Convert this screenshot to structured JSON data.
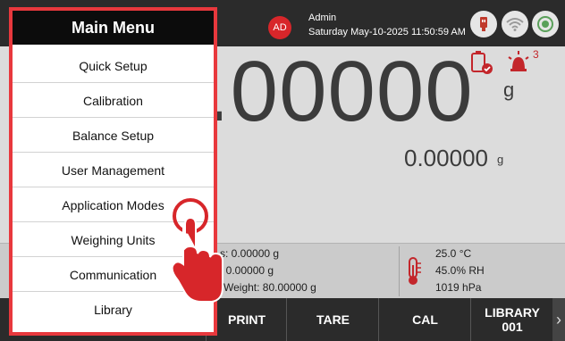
{
  "header": {
    "avatar_initials": "AD",
    "user_name": "Admin",
    "datetime": "Saturday May-10-2025 11:50:59 AM",
    "icons": [
      "usb-icon",
      "wifi-icon",
      "power-icon"
    ]
  },
  "main": {
    "weight_value": ".00000",
    "weight_unit": "g",
    "secondary_value": "0.00000",
    "secondary_unit": "g",
    "alarm_count": "3"
  },
  "info": {
    "stats": [
      "s: 0.00000 g",
      ": 0.00000 g",
      "-Weight: 80.00000 g"
    ],
    "environment": [
      "25.0 °C",
      "45.0% RH",
      "1019 hPa"
    ]
  },
  "buttons": {
    "print": "PRINT",
    "tare": "TARE",
    "cal": "CAL",
    "library_line1": "LIBRARY",
    "library_line2": "001"
  },
  "menu": {
    "title": "Main Menu",
    "items": [
      "Quick Setup",
      "Calibration",
      "Balance Setup",
      "User Management",
      "Application Modes",
      "Weighing Units",
      "Communication",
      "Library"
    ]
  },
  "colors": {
    "accent_red": "#e8383d",
    "top_bar": "#2b2b2b",
    "main_bg": "#dcdcdc"
  }
}
